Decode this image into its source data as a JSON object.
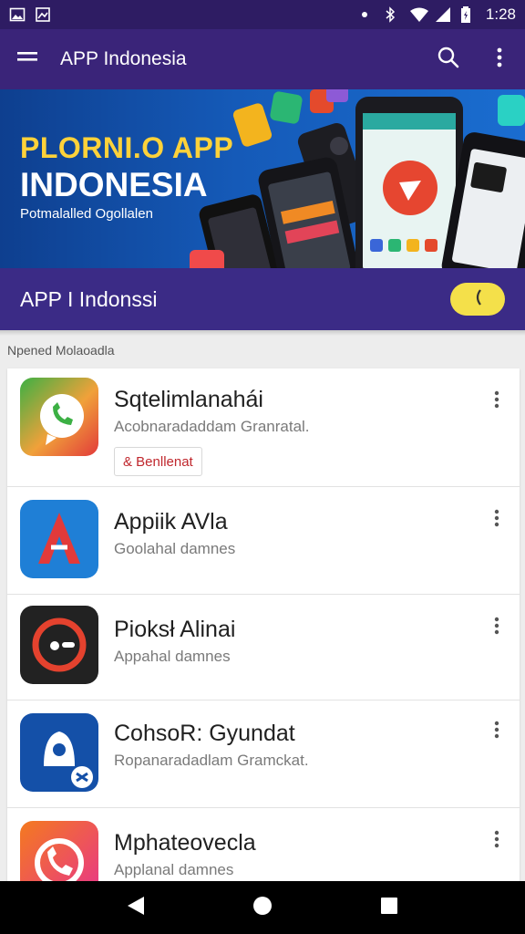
{
  "status_bar": {
    "time": "1:28",
    "icons": [
      "image-icon",
      "gallery-icon",
      "location-icon",
      "bluetooth-icon",
      "wifi-icon",
      "signal-icon",
      "battery-icon"
    ]
  },
  "app_bar": {
    "title": "APP Indonesia",
    "icons": [
      "menu-icon",
      "search-icon",
      "more-vert-icon"
    ]
  },
  "banner": {
    "title_line1": "PLORNI.O APP",
    "title_line2": "INDONESIA",
    "subtitle": "Potmalalled Ogollalen"
  },
  "section": {
    "title": "APP I Indonssi",
    "caption": "Npened Molaoadla"
  },
  "apps": [
    {
      "name": "Sqtelimlanahái",
      "description": "Acobnaradaddam Granratal.",
      "tag": "& Benllenat",
      "icon": "chat-phone-icon",
      "colors": [
        "#3cb044",
        "#f0a13a",
        "#e23a3a"
      ]
    },
    {
      "name": "Appiik AVla",
      "description": "Goolahal damnes",
      "tag": "",
      "icon": "letter-a-icon",
      "colors": [
        "#1f7fd6",
        "#e23a3a"
      ]
    },
    {
      "name": "Pioksł Alinai",
      "description": "Appahal damnes",
      "tag": "",
      "icon": "record-icon",
      "colors": [
        "#222222",
        "#e4422e"
      ]
    },
    {
      "name": "CohsoR: Gyundat",
      "description": "Ropanaradadlam Gramckat.",
      "tag": "",
      "icon": "bell-icon",
      "colors": [
        "#1450a8",
        "#ffffff"
      ]
    },
    {
      "name": "Mphateovecla",
      "description": "Applanal damnes",
      "tag": "",
      "icon": "phone-icon",
      "colors": [
        "#f47a1f",
        "#e8358a"
      ]
    }
  ],
  "nav": {
    "icons": [
      "back-icon",
      "home-icon",
      "recents-icon"
    ]
  }
}
